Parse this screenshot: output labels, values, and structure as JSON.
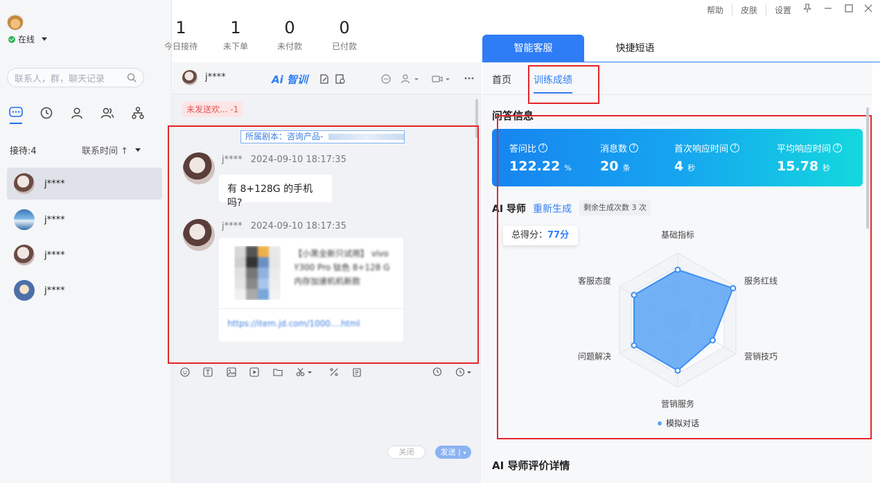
{
  "user": {
    "status": "在线"
  },
  "stats": [
    {
      "value": "1",
      "label": "今日接待"
    },
    {
      "value": "1",
      "label": "未下单"
    },
    {
      "value": "0",
      "label": "未付款"
    },
    {
      "value": "0",
      "label": "已付款"
    }
  ],
  "search": {
    "placeholder": "联系人，群，聊天记录"
  },
  "sidebar_tabs": [
    "chat-icon",
    "clock-icon",
    "person-icon",
    "group-icon",
    "org-chart-icon"
  ],
  "reception": {
    "label": "接待:4",
    "sort_label": "联系时间 ↑"
  },
  "contacts": [
    {
      "name": "j****"
    },
    {
      "name": "j****"
    },
    {
      "name": "j****"
    },
    {
      "name": "j****"
    }
  ],
  "chat": {
    "name": "j****",
    "ai_train": "Ai 智训",
    "unsent_badge": "未发送欢... -1",
    "script_tag": "所属剧本：咨询产品-",
    "messages": [
      {
        "sender": "j****",
        "time": "2024-09-10 18:17:35",
        "text": "有 8+128G 的手机吗?"
      },
      {
        "sender": "j****",
        "time": "2024-09-10 18:17:35",
        "card_title": "【小黑全新只试用】 vivo Y300 Pro 钛色 8+128 G内存加速机机新款",
        "card_link": "https://item.jd.com/1000....html"
      }
    ],
    "close_label": "关闭",
    "send_label": "发送 |"
  },
  "window": {
    "help": "帮助",
    "skin": "皮肤",
    "settings": "设置"
  },
  "right": {
    "tabs": [
      "智能客服",
      "快捷短语"
    ],
    "subtabs": [
      "首页",
      "训练成绩"
    ],
    "qa_title": "问答信息",
    "metrics": [
      {
        "label": "答问比",
        "value": "122.22",
        "unit": "%"
      },
      {
        "label": "消息数",
        "value": "20",
        "unit": "条"
      },
      {
        "label": "首次响应时间",
        "value": "4",
        "unit": "秒"
      },
      {
        "label": "平均响应时间",
        "value": "15.78",
        "unit": "秒"
      }
    ],
    "ai_title": "AI 导师",
    "regen": "重新生成",
    "remain": "剩余生成次数 3 次",
    "score_label": "总得分：",
    "score_value": "77分",
    "eval_title": "AI 导师评价详情"
  },
  "chart_data": {
    "type": "radar",
    "indicators": [
      "基础指标",
      "服务红线",
      "营销技巧",
      "营销服务",
      "问题解决",
      "客服态度"
    ],
    "series": [
      {
        "name": "模拟对话",
        "values": [
          75,
          95,
          60,
          75,
          75,
          75
        ]
      }
    ],
    "max": 100
  },
  "colors": {
    "accent": "#2f7df6",
    "highlight_box": "#e3262b",
    "radar_fill": "#5ba3f5"
  }
}
